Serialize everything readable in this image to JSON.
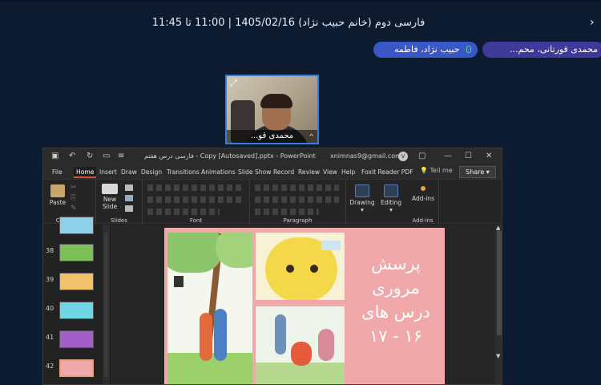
{
  "meeting": {
    "title": "فارسی دوم (خانم حبیب نژاد) 1405/02/16 | 11:00 تا 11:45",
    "back_glyph": "›"
  },
  "participants": {
    "chip_a": "حبیب نژاد، فاطمه",
    "chip_b": "محمدی قورتانی، محم..."
  },
  "video": {
    "name": "محمدی قو..."
  },
  "powerpoint": {
    "title": "فارسی درس هفتم - Copy [Autosaved].pptx  -  PowerPoint",
    "email": "xnimnas9@gmail.com",
    "avatar_letter": "V",
    "tabs": [
      "File",
      "Home",
      "Insert",
      "Draw",
      "Design",
      "Transitions",
      "Animations",
      "Slide Show",
      "Record",
      "Review",
      "View",
      "Help",
      "Foxit Reader PDF"
    ],
    "tell_me": "Tell me",
    "share": "Share",
    "ribbon": {
      "paste": "Paste",
      "clipboard": "Clipboard",
      "new_slide_1": "New",
      "new_slide_2": "Slide",
      "slides": "Slides",
      "font": "Font",
      "paragraph": "Paragraph",
      "drawing": "Drawing",
      "editing": "Editing",
      "addins_btn": "Add-ins",
      "addins_group": "Add-ins"
    },
    "thumbnails": [
      {
        "num": "38"
      },
      {
        "num": "39"
      },
      {
        "num": "40"
      },
      {
        "num": "41"
      },
      {
        "num": "42"
      }
    ],
    "slide_text": [
      "پرسش",
      "مروری",
      "درس های",
      "۱۶ - ۱۷"
    ]
  },
  "colors": {
    "background": "#0c1b2f",
    "chip_a": "#3a57c7",
    "chip_b": "#3d3a9a",
    "video_border": "#3b7bd9",
    "slide_pink": "#f0a8aa",
    "ppt_accent": "#d35230",
    "mic_green": "#4fe36b"
  }
}
